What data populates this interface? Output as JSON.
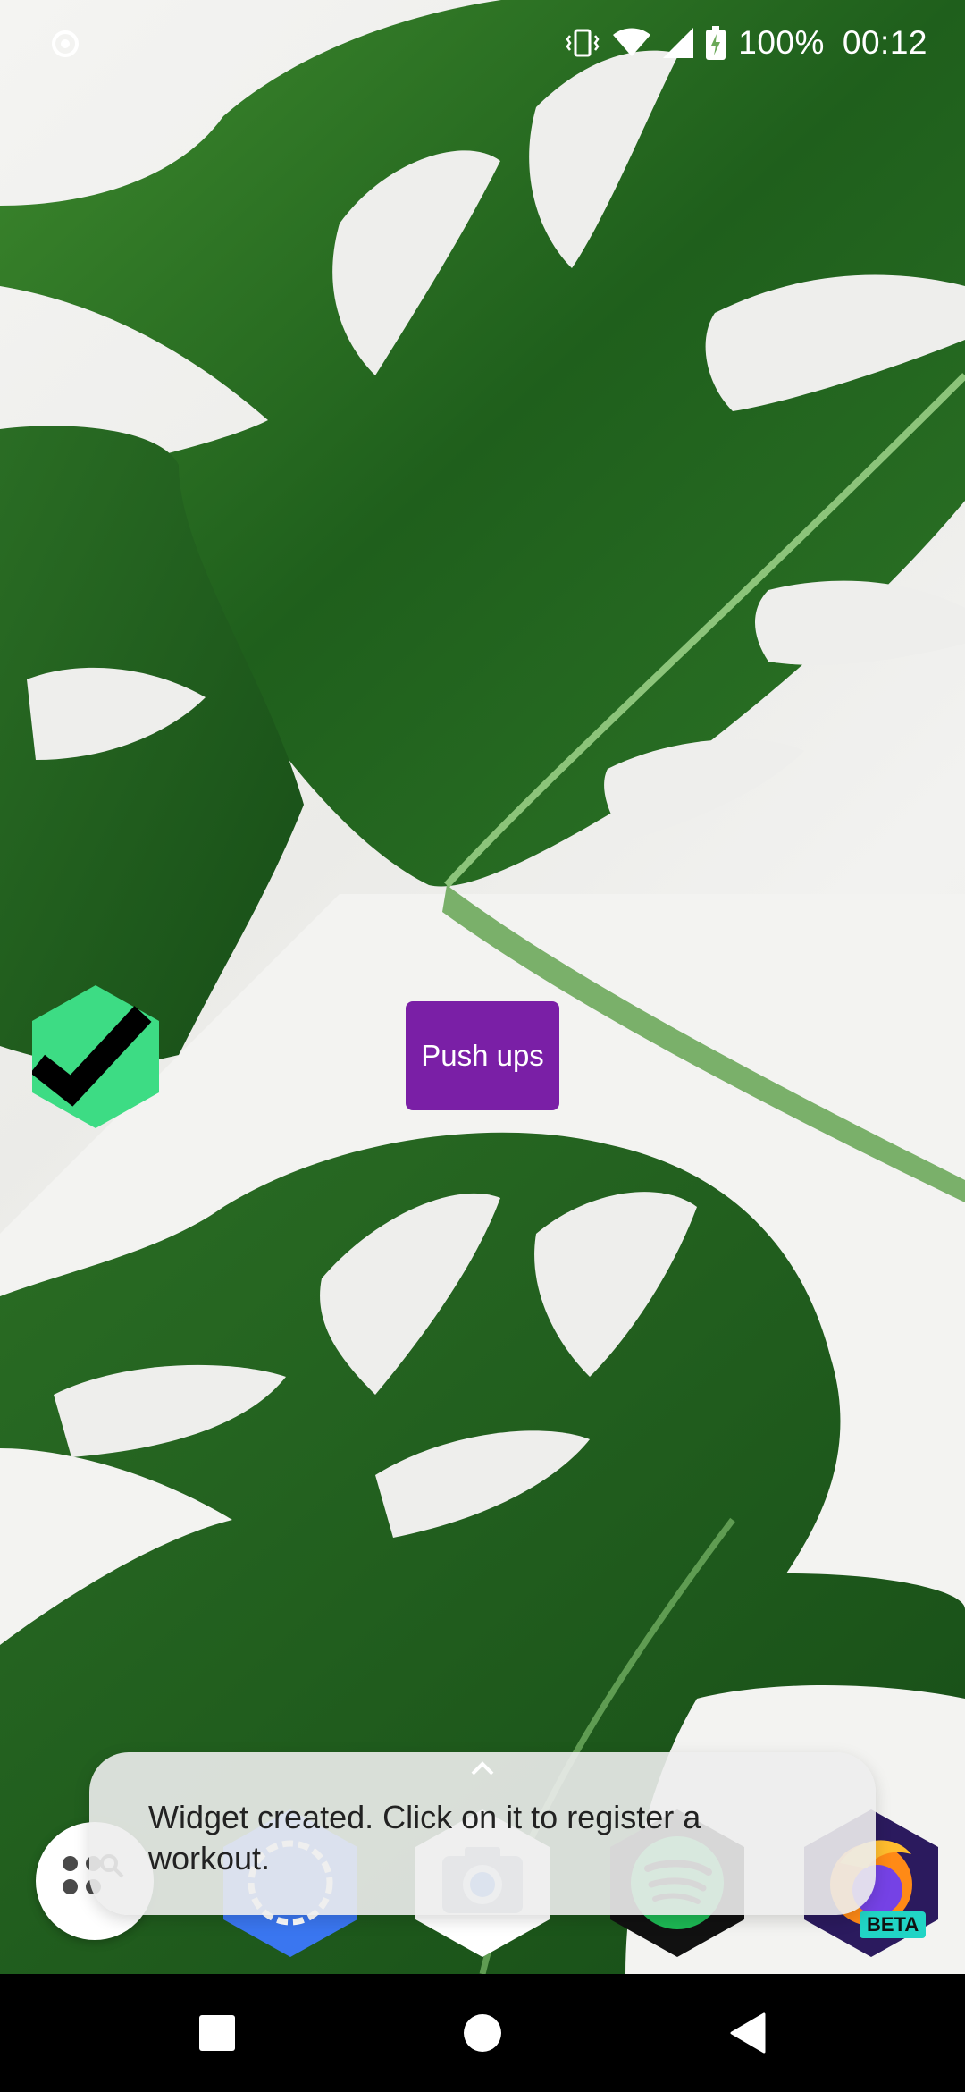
{
  "status_bar": {
    "battery": "100%",
    "time": "00:12",
    "icons": [
      "record-icon",
      "vibrate-icon",
      "wifi-icon",
      "signal-icon",
      "battery-charging-icon"
    ]
  },
  "widgets": {
    "check_icon": "hexagon-check-icon",
    "push_ups_label": "Push ups",
    "push_ups_color": "#7a1fa6"
  },
  "dock": {
    "apps": [
      "app-drawer-icon",
      "signal-app-icon",
      "camera-app-icon",
      "spotify-app-icon",
      "firefox-beta-app-icon"
    ],
    "firefox_badge": "BETA"
  },
  "snackbar": {
    "message": "Widget created. Click on it to register a workout."
  },
  "nav_bar": {
    "buttons": [
      "recents-button",
      "home-button",
      "back-button"
    ]
  }
}
